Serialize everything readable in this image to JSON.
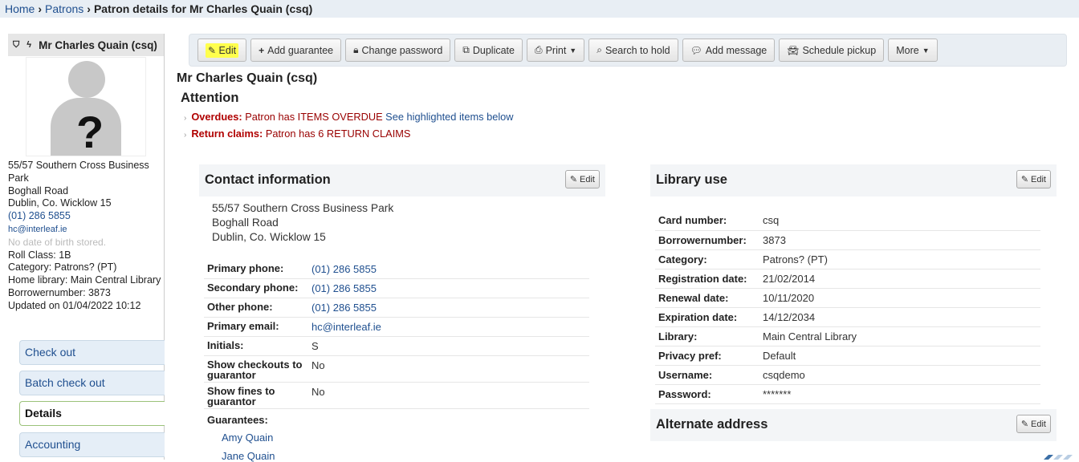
{
  "breadcrumb": {
    "home": "Home",
    "patrons": "Patrons",
    "current": "Patron details for Mr Charles Quain (csq)"
  },
  "patron": {
    "name": "Mr Charles Quain (csq)",
    "address_line1": "55/57 Southern Cross Business Park",
    "address_line2": "Boghall Road",
    "address_line3": "Dublin, Co. Wicklow 15",
    "phone": "(01) 286 5855",
    "email": "hc@interleaf.ie",
    "dob": "No date of birth stored.",
    "roll_class": "Roll Class: 1B",
    "category": "Category: Patrons? (PT)",
    "home_library": "Home library: Main Central Library",
    "borrowernumber": "Borrowernumber: 3873",
    "updated": "Updated on 01/04/2022 10:12"
  },
  "leftnav": {
    "checkout": "Check out",
    "batch": "Batch check out",
    "details": "Details",
    "accounting": "Accounting"
  },
  "toolbar": {
    "edit": "Edit",
    "add_guarantee": "Add guarantee",
    "change_password": "Change password",
    "duplicate": "Duplicate",
    "print": "Print",
    "search_to_hold": "Search to hold",
    "add_message": "Add message",
    "schedule_pickup": "Schedule pickup",
    "more": "More"
  },
  "main": {
    "title": "Mr Charles Quain (csq)",
    "attention": "Attention",
    "overdues_label": "Overdues:",
    "overdues_text": "Patron has ITEMS OVERDUE",
    "overdues_link": "See highlighted items below",
    "claims_label": "Return claims:",
    "claims_text": "Patron has 6 RETURN CLAIMS"
  },
  "contact": {
    "heading": "Contact information",
    "edit": "Edit",
    "address": [
      "55/57 Southern Cross Business Park",
      "Boghall Road",
      "Dublin, Co. Wicklow 15"
    ],
    "rows": [
      {
        "label": "Primary phone:",
        "value": "(01) 286 5855"
      },
      {
        "label": "Secondary phone:",
        "value": "(01) 286 5855"
      },
      {
        "label": "Other phone:",
        "value": "(01) 286 5855"
      },
      {
        "label": "Primary email:",
        "value": "hc@interleaf.ie"
      },
      {
        "label": "Initials:",
        "value": "S"
      },
      {
        "label": "Show checkouts to guarantor",
        "value": "No"
      },
      {
        "label": "Show fines to guarantor",
        "value": "No"
      }
    ],
    "guarantees_label": "Guarantees:",
    "guarantees": [
      "Amy Quain",
      "Jane Quain"
    ]
  },
  "library_use": {
    "heading": "Library use",
    "edit": "Edit",
    "rows": [
      {
        "label": "Card number:",
        "value": "csq"
      },
      {
        "label": "Borrowernumber:",
        "value": "3873"
      },
      {
        "label": "Category:",
        "value": "Patrons? (PT)"
      },
      {
        "label": "Registration date:",
        "value": "21/02/2014"
      },
      {
        "label": "Renewal date:",
        "value": "10/11/2020"
      },
      {
        "label": "Expiration date:",
        "value": "14/12/2034"
      },
      {
        "label": "Library:",
        "value": "Main Central Library"
      },
      {
        "label": "Privacy pref:",
        "value": "Default"
      },
      {
        "label": "Username:",
        "value": "csqdemo"
      },
      {
        "label": "Password:",
        "value": "*******"
      }
    ]
  },
  "alternate": {
    "heading": "Alternate address",
    "edit": "Edit"
  },
  "colors": {
    "link": "#1f4f8f",
    "alert": "#b00000",
    "highlight": "#ffff4d",
    "toolbar_bg": "#e9eef3"
  },
  "icons": [
    "shield-icon",
    "bolt-icon",
    "pencil-icon",
    "plus-icon",
    "lock-icon",
    "copy-icon",
    "printer-icon",
    "search-icon",
    "comment-icon",
    "car-icon",
    "caret-down-icon"
  ]
}
